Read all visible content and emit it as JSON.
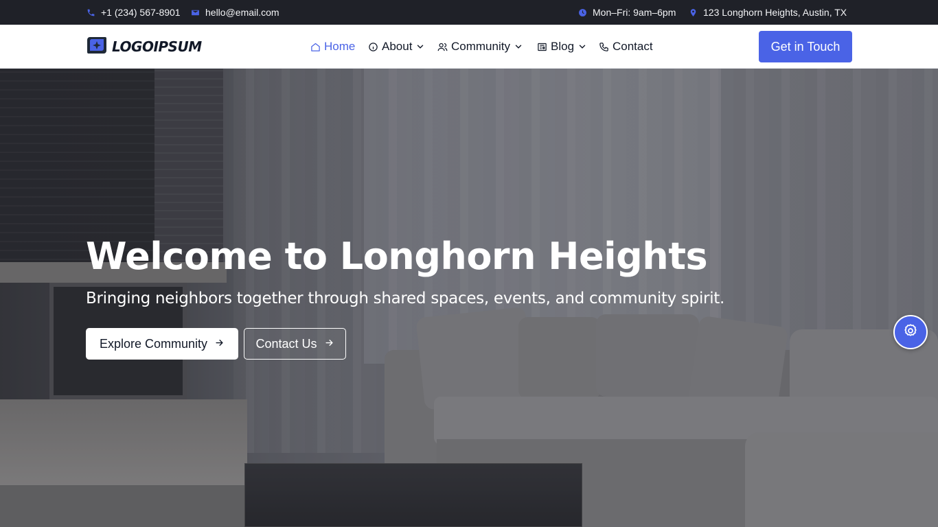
{
  "topbar": {
    "phone": "+1 (234) 567-8901",
    "email": "hello@email.com",
    "hours": "Mon–Fri: 9am–6pm",
    "address": "123 Longhorn Heights, Austin, TX",
    "icons": {
      "phone": "phone-icon",
      "email": "mail-icon",
      "hours": "clock-icon",
      "address": "map-pin-icon"
    },
    "icon_color": "#4a63e6"
  },
  "nav": {
    "logo_text": "LOGOIPSUM",
    "items": [
      {
        "label": "Home",
        "icon": "home-icon",
        "active": true,
        "dropdown": false
      },
      {
        "label": "About",
        "icon": "info-icon",
        "active": false,
        "dropdown": true
      },
      {
        "label": "Community",
        "icon": "users-icon",
        "active": false,
        "dropdown": true
      },
      {
        "label": "Blog",
        "icon": "newspaper-icon",
        "active": false,
        "dropdown": true
      },
      {
        "label": "Contact",
        "icon": "phone-icon",
        "active": false,
        "dropdown": false
      }
    ],
    "cta_label": "Get in Touch",
    "accent": "#4a63e6"
  },
  "hero": {
    "title": "Welcome to Longhorn Heights",
    "subtitle": "Bringing neighbors together through shared spaces, events, and community spirit.",
    "primary_button": "Explore Community",
    "secondary_button": "Contact Us"
  },
  "floating": {
    "settings_icon": "gear-icon"
  }
}
